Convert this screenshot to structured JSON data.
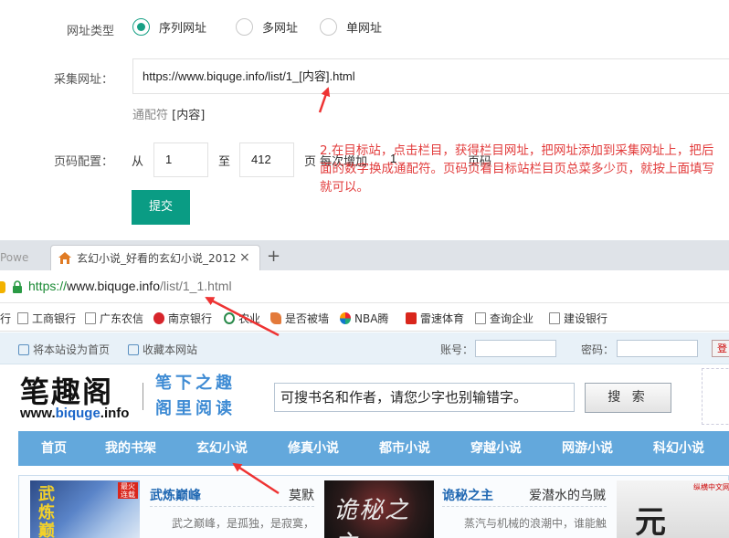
{
  "form": {
    "url_type_label": "网址类型",
    "url_type_options": [
      "序列网址",
      "多网址",
      "单网址"
    ],
    "collect_url_label": "采集网址：",
    "collect_url_value": "https://www.biquge.info/list/1_[内容].html",
    "wildcard_hint_prefix": "通配符",
    "wildcard_hint_value": "[内容]",
    "page_config_label": "页码配置：",
    "from_label": "从",
    "from_value": "1",
    "to_label": "至",
    "to_value": "412",
    "page_label": "页",
    "step_label": "每次增加",
    "step_value": "1",
    "step_suffix": "页码",
    "submit_label": "提交",
    "note": "2.在目标站，点击栏目，获得栏目网址，把网址添加到采集网址上，把后面的数字换成通配符。页码页看目标站栏目页总菜多少页，就按上面填写就可以。",
    "note_color": "#e23b3b",
    "accent": "#0a9c84"
  },
  "browser": {
    "inactive_tab": "Powe",
    "active_tab": "玄幻小说_好看的玄幻小说_2012",
    "new_tab": "+",
    "close_tab": "×",
    "url_scheme": "https://",
    "url_host": "www.biquge.info",
    "url_path": "/list/1_1.html",
    "bookmarks": [
      {
        "label": "行",
        "icon": "doc-icon"
      },
      {
        "label": "工商银行",
        "icon": "doc-icon"
      },
      {
        "label": "广东农信",
        "icon": "doc-icon"
      },
      {
        "label": "南京银行",
        "icon": "bank-icon"
      },
      {
        "label": "农业",
        "icon": "circle-icon"
      },
      {
        "label": "是否被墙",
        "icon": "tag-icon"
      },
      {
        "label": "NBA腾",
        "icon": "multicolor-icon"
      },
      {
        "label": "雷速体育",
        "icon": "red-square-icon"
      },
      {
        "label": "查询企业",
        "icon": "doc-icon"
      },
      {
        "label": "建设银行",
        "icon": "doc-icon"
      }
    ]
  },
  "site": {
    "set_home": "将本站设为首页",
    "bookmark_site": "收藏本网站",
    "account_label": "账号：",
    "password_label": "密码：",
    "login_btn": "登",
    "logo_main": "笔趣阁",
    "logo_url_prefix": "www.",
    "logo_url_brand": "biquge",
    "logo_url_suffix": ".info",
    "logo_slogan_1": "笔下之趣",
    "logo_slogan_2": "阁里阅读",
    "search_placeholder": "可搜书名和作者，请您少字也别输错字。",
    "search_button": "搜 索",
    "nav_color": "#63a8dc",
    "nav": [
      "首页",
      "我的书架",
      "玄幻小说",
      "修真小说",
      "都市小说",
      "穿越小说",
      "网游小说",
      "科幻小说"
    ],
    "books": [
      {
        "title": "武炼巅峰",
        "author": "莫默",
        "desc": "武之巅峰，是孤独，是寂寞，",
        "cover_text": "武炼巅",
        "cover_badge": "最火连载"
      },
      {
        "title": "诡秘之主",
        "author": "爱潜水的乌贼",
        "desc": "蒸汽与机械的浪潮中，谁能触",
        "cover_text": "诡秘之主"
      },
      {
        "cover_text": "元",
        "cover_badge": "纵横中文网"
      }
    ]
  }
}
